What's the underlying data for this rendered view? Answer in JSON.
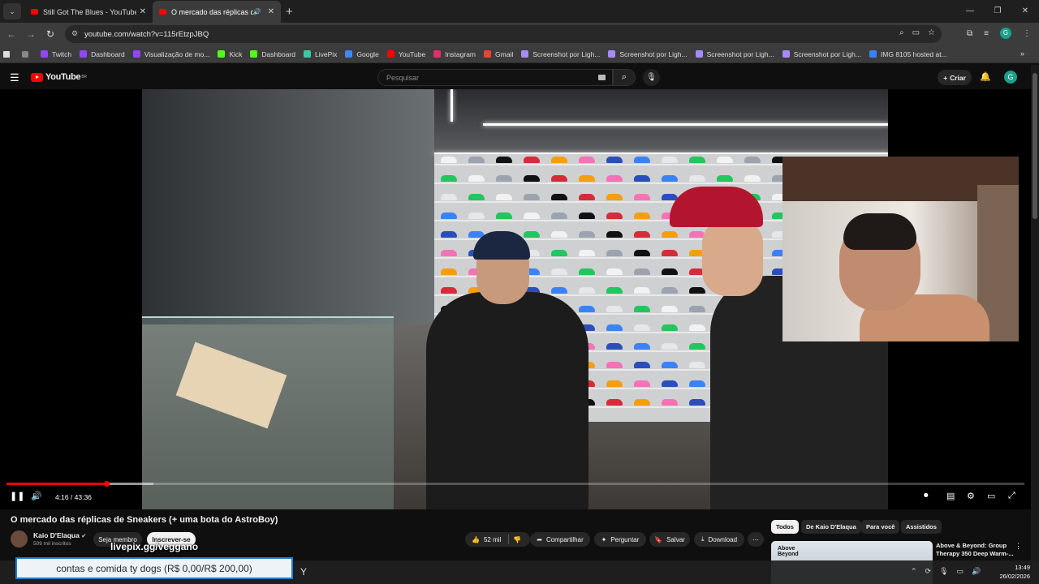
{
  "browser": {
    "tabs": [
      {
        "title": "Still Got The Blues - YouTube",
        "active": false
      },
      {
        "title": "O mercado das réplicas de",
        "active": true
      }
    ],
    "url": "youtube.com/watch?v=115rEtzpJBQ",
    "profile_initial": "G",
    "bookmarks": [
      {
        "label": "Twitch",
        "color": "#9146ff"
      },
      {
        "label": "Dashboard",
        "color": "#9146ff"
      },
      {
        "label": "Visualização de mo...",
        "color": "#9146ff"
      },
      {
        "label": "Kick",
        "color": "#53fc18"
      },
      {
        "label": "Dashboard",
        "color": "#53fc18"
      },
      {
        "label": "LivePix",
        "color": "#38c9a8"
      },
      {
        "label": "Google",
        "color": "#4285f4"
      },
      {
        "label": "YouTube",
        "color": "#ff0000"
      },
      {
        "label": "Instagram",
        "color": "#e1306c"
      },
      {
        "label": "Gmail",
        "color": "#ea4335"
      },
      {
        "label": "Screenshot por Ligh...",
        "color": "#a78bfa"
      },
      {
        "label": "Screenshot por Ligh...",
        "color": "#a78bfa"
      },
      {
        "label": "Screenshot por Ligh...",
        "color": "#a78bfa"
      },
      {
        "label": "Screenshot por Ligh...",
        "color": "#a78bfa"
      },
      {
        "label": "IMG 8105 hosted at...",
        "color": "#3b82f6"
      }
    ]
  },
  "youtube": {
    "logo_text": "YouTube",
    "logo_region": "BR",
    "search_placeholder": "Pesquisar",
    "create_label": "Criar",
    "avatar_initial": "G"
  },
  "player": {
    "current_time": "4:16",
    "duration": "43:36",
    "time_display": "4:16 / 43:36",
    "progress_fraction": 0.0979,
    "buffer_fraction": 0.144
  },
  "video": {
    "title": "O mercado das réplicas de Sneakers (+ uma bota do AstroBoy)",
    "channel": "Kaio D'Elaqua",
    "subscribers": "509 mil inscritos",
    "join_label": "Seja membro",
    "subscribe_label": "Inscrever-se",
    "likes": "52 mil",
    "share_label": "Compartilhar",
    "ask_label": "Perguntar",
    "save_label": "Salvar",
    "download_label": "Download"
  },
  "recommendations": {
    "chips": [
      "Todos",
      "De Kaio D'Elaqua",
      "Para você",
      "Assistidos"
    ],
    "first": {
      "title": "Above & Beyond: Group Therapy 350 Deep Warm-...",
      "thumb_text": "Above Beyond"
    }
  },
  "overlay": {
    "livepix": "livepix.gg/veggano",
    "goal": "contas e comida ty dogs (R$ 0,00/R$ 200,00)"
  },
  "taskbar": {
    "time": "13:49",
    "date": "26/02/2026"
  }
}
